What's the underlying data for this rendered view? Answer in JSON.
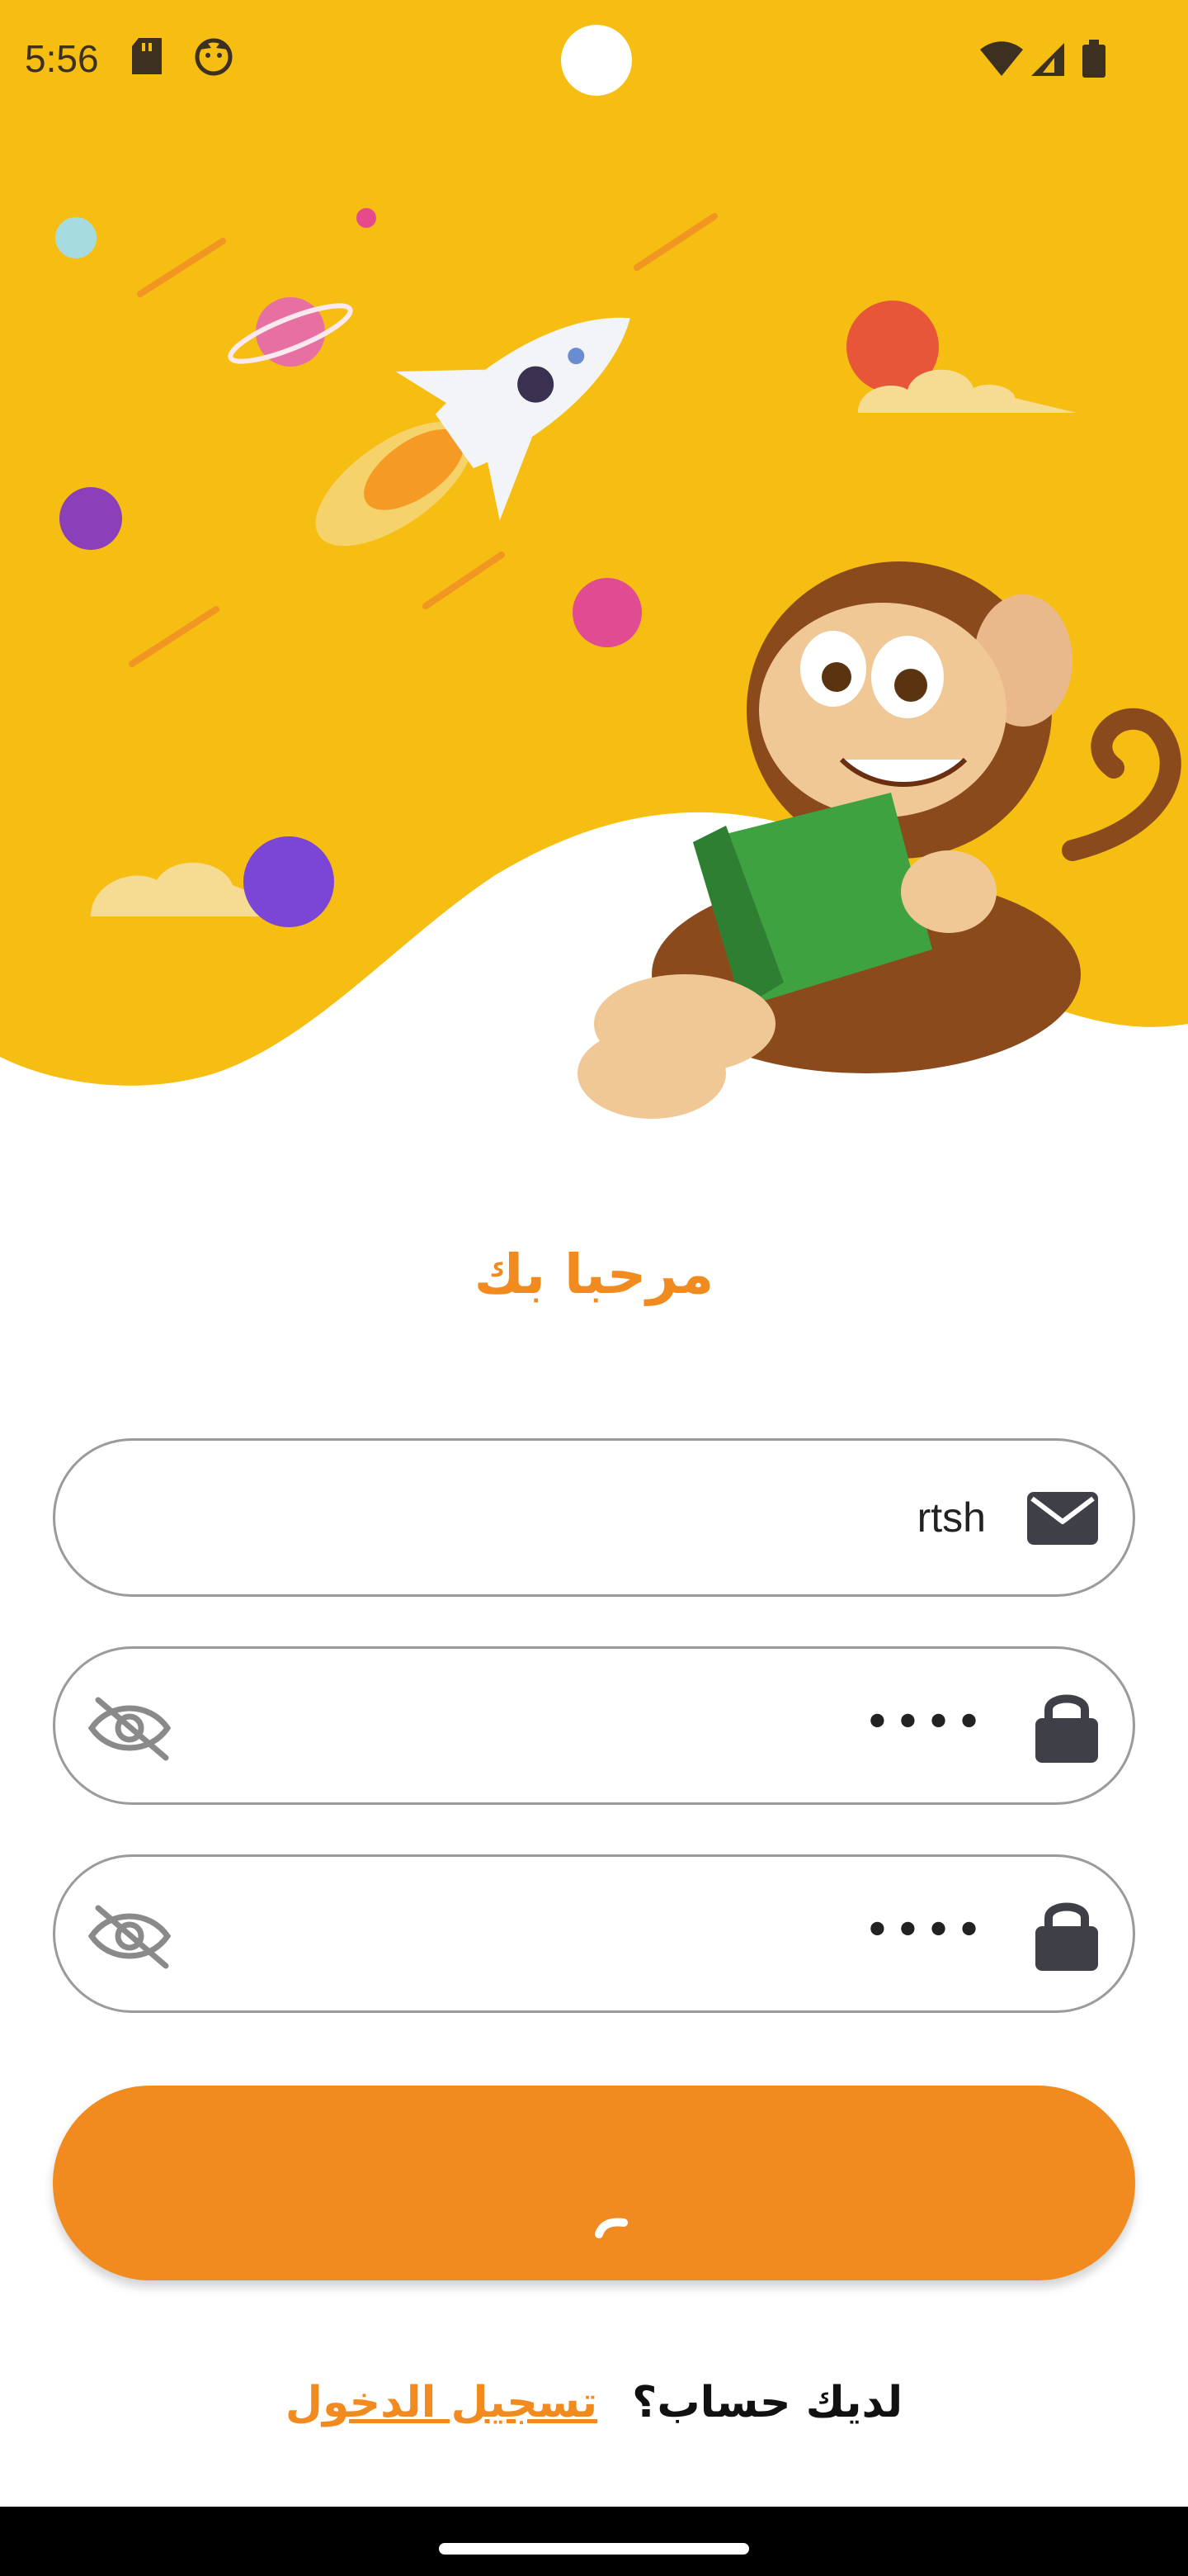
{
  "status_bar": {
    "time": "5:56",
    "icons": [
      "sd-card-icon",
      "face-icon",
      "wifi-icon",
      "signal-icon",
      "battery-icon"
    ]
  },
  "colors": {
    "accent": "#f28b1f",
    "hero_yellow": "#f6bd12",
    "border": "#9a9a9a"
  },
  "hero": {
    "illustration": "monkey-reading-book-with-rocket-and-planets"
  },
  "form": {
    "title": "مرحبا بك",
    "email": {
      "value": "rtsh",
      "icon": "envelope-icon"
    },
    "password": {
      "masked_value": "••••",
      "icon": "lock-icon",
      "toggle_icon": "eye-off-icon"
    },
    "confirm_password": {
      "masked_value": "••••",
      "icon": "lock-icon",
      "toggle_icon": "eye-off-icon"
    },
    "submit": {
      "state": "loading"
    }
  },
  "footer": {
    "question": "لديك حساب؟",
    "link": "تسجيل الدخول"
  }
}
